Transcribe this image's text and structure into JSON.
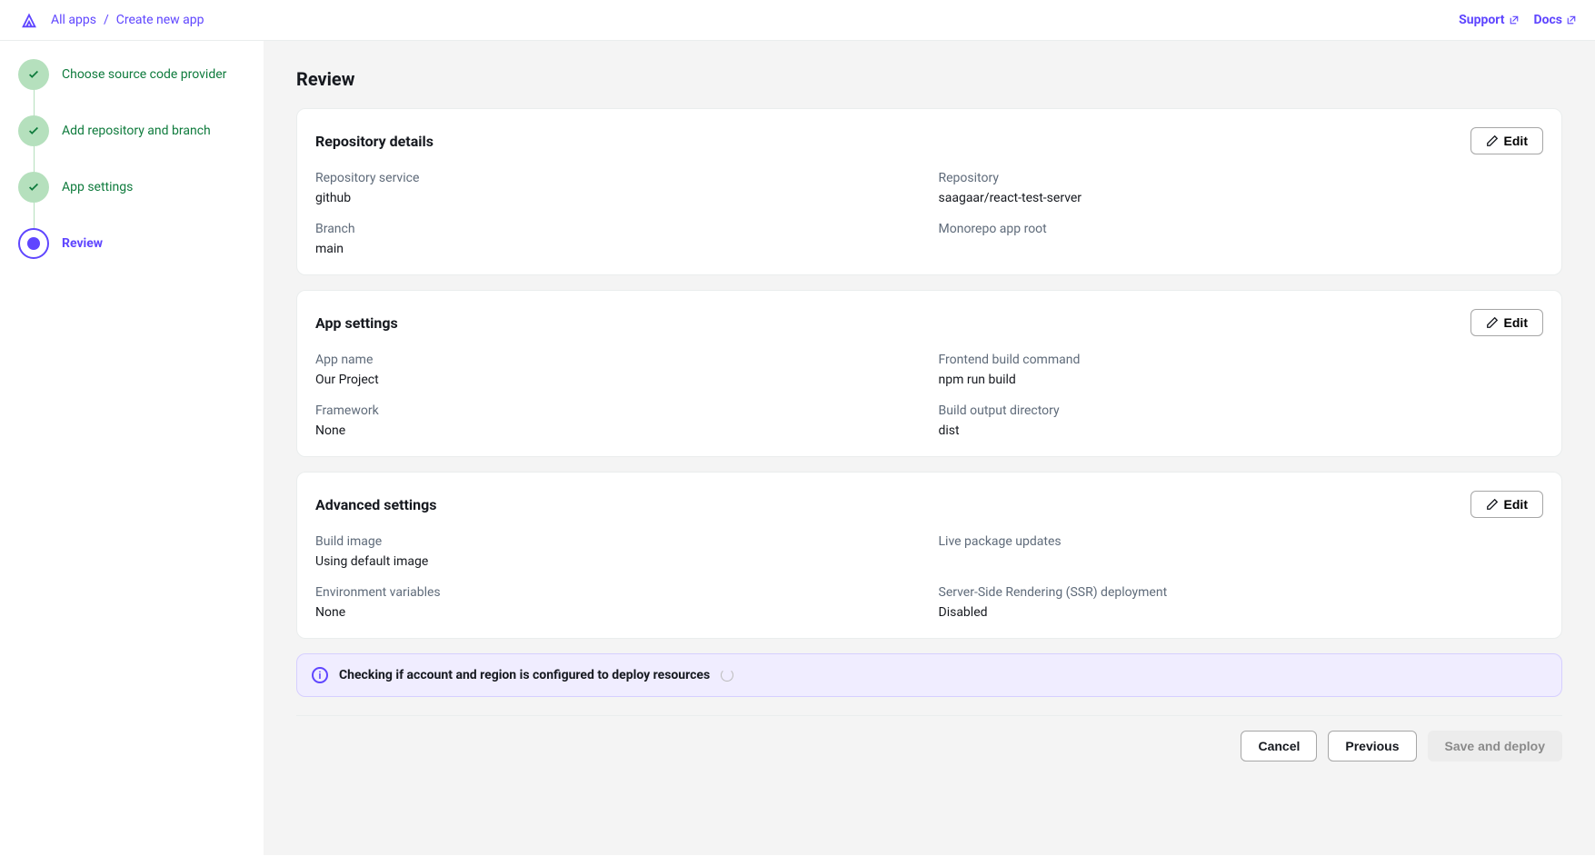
{
  "header": {
    "breadcrumb": [
      "All apps",
      "Create new app"
    ],
    "links": {
      "support": "Support",
      "docs": "Docs"
    }
  },
  "sidebar": {
    "steps": [
      {
        "label": "Choose source code provider",
        "state": "done"
      },
      {
        "label": "Add repository and branch",
        "state": "done"
      },
      {
        "label": "App settings",
        "state": "done"
      },
      {
        "label": "Review",
        "state": "current"
      }
    ]
  },
  "page": {
    "title": "Review",
    "edit_label": "Edit"
  },
  "cards": {
    "repository": {
      "title": "Repository details",
      "fields": {
        "service": {
          "label": "Repository service",
          "value": "github"
        },
        "repo": {
          "label": "Repository",
          "value": "saagaar/react-test-server"
        },
        "branch": {
          "label": "Branch",
          "value": "main"
        },
        "monorepo": {
          "label": "Monorepo app root",
          "value": ""
        }
      }
    },
    "app": {
      "title": "App settings",
      "fields": {
        "name": {
          "label": "App name",
          "value": "Our Project"
        },
        "build_cmd": {
          "label": "Frontend build command",
          "value": "npm run build"
        },
        "framework": {
          "label": "Framework",
          "value": "None"
        },
        "output": {
          "label": "Build output directory",
          "value": "dist"
        }
      }
    },
    "advanced": {
      "title": "Advanced settings",
      "fields": {
        "build_image": {
          "label": "Build image",
          "value": "Using default image"
        },
        "live_updates": {
          "label": "Live package updates",
          "value": ""
        },
        "env_vars": {
          "label": "Environment variables",
          "value": "None"
        },
        "ssr": {
          "label": "Server-Side Rendering (SSR) deployment",
          "value": "Disabled"
        }
      }
    }
  },
  "banner": {
    "text": "Checking if account and region is configured to deploy resources"
  },
  "footer": {
    "cancel": "Cancel",
    "previous": "Previous",
    "save": "Save and deploy"
  }
}
